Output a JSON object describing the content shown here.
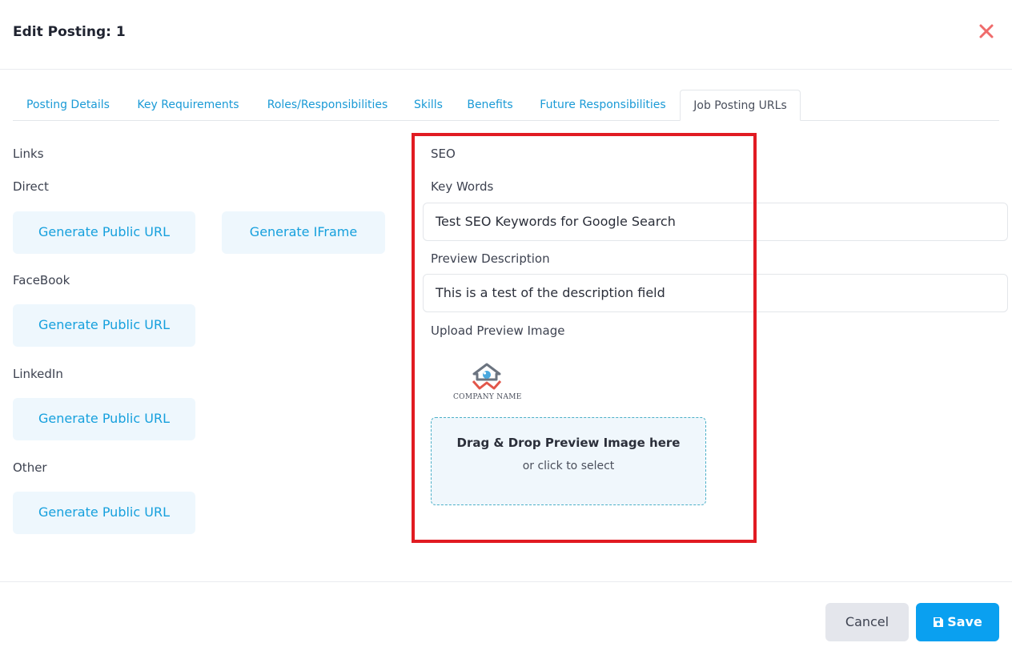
{
  "header": {
    "title": "Edit Posting: 1",
    "close_icon": "close-icon"
  },
  "tabs": [
    {
      "label": "Posting Details"
    },
    {
      "label": "Key Requirements"
    },
    {
      "label": "Roles/Responsibilities"
    },
    {
      "label": "Skills"
    },
    {
      "label": "Benefits"
    },
    {
      "label": "Future Responsibilities"
    },
    {
      "label": "Job Posting URLs",
      "active": true
    }
  ],
  "links": {
    "heading": "Links",
    "direct": {
      "label": "Direct",
      "public_url_button": "Generate Public URL",
      "iframe_button": "Generate IFrame"
    },
    "facebook": {
      "label": "FaceBook",
      "public_url_button": "Generate Public URL"
    },
    "linkedin": {
      "label": "LinkedIn",
      "public_url_button": "Generate Public URL"
    },
    "other": {
      "label": "Other",
      "public_url_button": "Generate Public URL"
    }
  },
  "seo": {
    "heading": "SEO",
    "keywords_label": "Key Words",
    "keywords_value": "Test SEO Keywords  for Google Search",
    "description_label": "Preview Description",
    "description_value": "This is a test of the description field",
    "upload_label": "Upload Preview Image",
    "logo_text": "COMPANY NAME",
    "dropzone_main": "Drag & Drop Preview Image here",
    "dropzone_sub": "or click to select"
  },
  "footer": {
    "cancel_label": "Cancel",
    "save_label": "Save",
    "save_icon": "floppy-disk-icon"
  },
  "colors": {
    "accent": "#0aa0f0",
    "link": "#16a0dd",
    "highlight_box": "#e11b22",
    "close": "#ef6b6b"
  }
}
